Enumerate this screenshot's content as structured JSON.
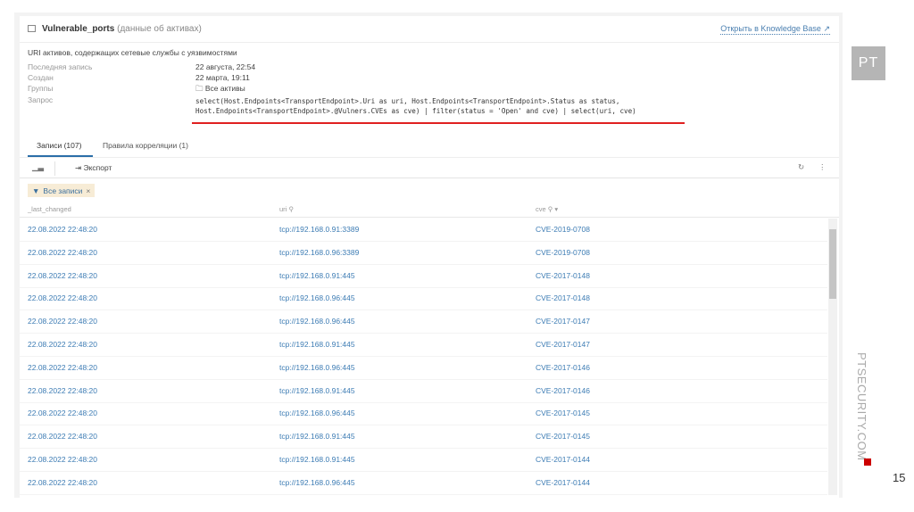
{
  "header": {
    "title": "Vulnerable_ports",
    "subtitle": "(данные об активах)",
    "kb_link": "Открыть в Knowledge Base"
  },
  "description": "URI активов, содержащих сетевые службы с уязвимостями",
  "meta": [
    {
      "label": "Последняя запись",
      "value": "22 августа, 22:54"
    },
    {
      "label": "Создан",
      "value": "22 марта, 19:11"
    },
    {
      "label": "Группы",
      "value": "Все активы"
    },
    {
      "label": "Запрос",
      "value": "select(Host.Endpoints<TransportEndpoint>.Uri as uri, Host.Endpoints<TransportEndpoint>.Status as status,\nHost.Endpoints<TransportEndpoint>.@Vulners.CVEs as cve) | filter(status = 'Open' and cve) | select(uri, cve)"
    }
  ],
  "tabs": [
    {
      "label": "Записи (107)"
    },
    {
      "label": "Правила корреляции (1)"
    }
  ],
  "toolbar": {
    "export": "Экспорт"
  },
  "filter_chip": "Все записи",
  "columns": [
    "_last_changed",
    "uri",
    "cve"
  ],
  "rows": [
    [
      "22.08.2022 22:48:20",
      "tcp://192.168.0.91:3389",
      "CVE-2019-0708"
    ],
    [
      "22.08.2022 22:48:20",
      "tcp://192.168.0.96:3389",
      "CVE-2019-0708"
    ],
    [
      "22.08.2022 22:48:20",
      "tcp://192.168.0.91:445",
      "CVE-2017-0148"
    ],
    [
      "22.08.2022 22:48:20",
      "tcp://192.168.0.96:445",
      "CVE-2017-0148"
    ],
    [
      "22.08.2022 22:48:20",
      "tcp://192.168.0.96:445",
      "CVE-2017-0147"
    ],
    [
      "22.08.2022 22:48:20",
      "tcp://192.168.0.91:445",
      "CVE-2017-0147"
    ],
    [
      "22.08.2022 22:48:20",
      "tcp://192.168.0.96:445",
      "CVE-2017-0146"
    ],
    [
      "22.08.2022 22:48:20",
      "tcp://192.168.0.91:445",
      "CVE-2017-0146"
    ],
    [
      "22.08.2022 22:48:20",
      "tcp://192.168.0.96:445",
      "CVE-2017-0145"
    ],
    [
      "22.08.2022 22:48:20",
      "tcp://192.168.0.91:445",
      "CVE-2017-0145"
    ],
    [
      "22.08.2022 22:48:20",
      "tcp://192.168.0.91:445",
      "CVE-2017-0144"
    ],
    [
      "22.08.2022 22:48:20",
      "tcp://192.168.0.96:445",
      "CVE-2017-0144"
    ]
  ],
  "slide": {
    "logo": "PT",
    "site": "PTSECURITY.COM",
    "page": "15"
  }
}
